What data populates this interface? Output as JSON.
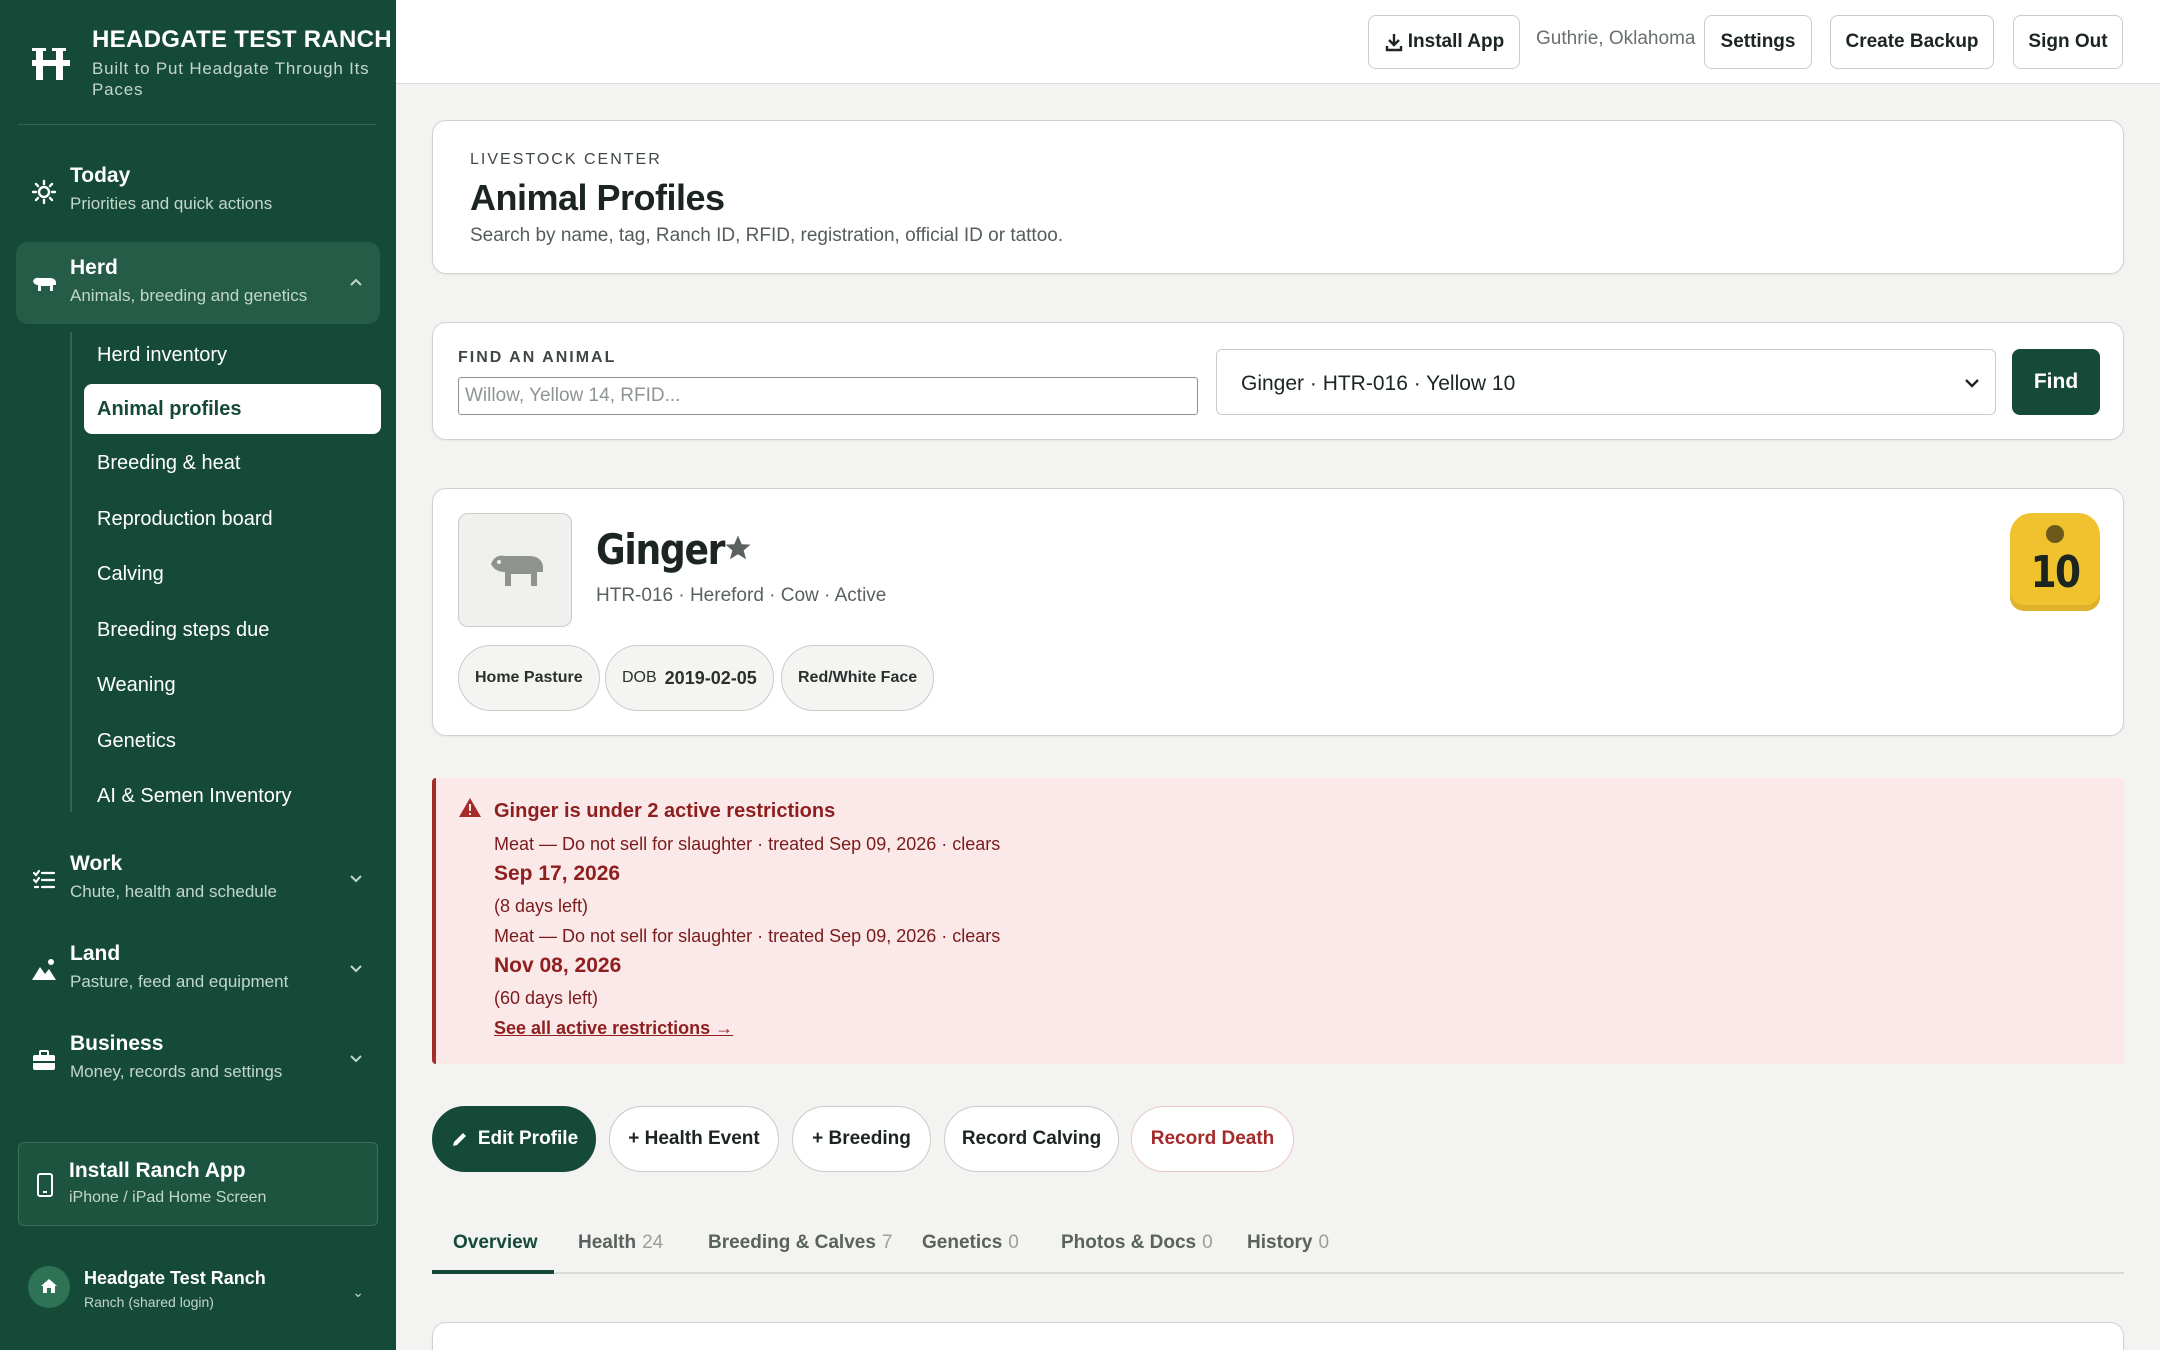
{
  "brand": {
    "title": "HEADGATE TEST RANCH",
    "subtitle": "Built to Put Headgate Through Its Paces",
    "logo_letter": "H"
  },
  "nav": {
    "groups": [
      {
        "title": "Today",
        "subtitle": "Priorities and quick actions",
        "icon": "sun-icon"
      },
      {
        "title": "Herd",
        "subtitle": "Animals, breeding and genetics",
        "icon": "cow-icon",
        "expanded": true
      },
      {
        "title": "Work",
        "subtitle": "Chute, health and schedule",
        "icon": "checklist-icon"
      },
      {
        "title": "Land",
        "subtitle": "Pasture, feed and equipment",
        "icon": "mountain-icon"
      },
      {
        "title": "Business",
        "subtitle": "Money, records and settings",
        "icon": "briefcase-icon"
      }
    ],
    "herd_items": [
      "Herd inventory",
      "Animal profiles",
      "Breeding & heat",
      "Reproduction board",
      "Calving",
      "Breeding steps due",
      "Weaning",
      "Genetics",
      "AI & Semen Inventory"
    ],
    "active_item": "Animal profiles"
  },
  "install_card": {
    "title": "Install Ranch App",
    "subtitle": "iPhone / iPad Home Screen"
  },
  "account": {
    "name": "Headgate Test Ranch",
    "role": "Ranch (shared login)",
    "chevron": "⌄"
  },
  "topbar": {
    "install": "Install App",
    "location": "Guthrie, Oklahoma",
    "settings": "Settings",
    "backup": "Create Backup",
    "signout": "Sign Out"
  },
  "header": {
    "eyebrow": "LIVESTOCK CENTER",
    "title": "Animal Profiles",
    "description": "Search by name, tag, Ranch ID, RFID, registration, official ID or tattoo."
  },
  "find": {
    "label": "FIND AN ANIMAL",
    "placeholder": "Willow, Yellow 14, RFID...",
    "selected": "Ginger · HTR-016 · Yellow 10",
    "button": "Find"
  },
  "animal": {
    "name": "Ginger",
    "meta": "HTR-016 · Hereford · Cow · Active",
    "chips": {
      "pasture": "Home Pasture",
      "dob_label": "DOB",
      "dob": "2019-02-05",
      "marking": "Red/White Face"
    },
    "tag_number": "10",
    "tag_color": "#f0c22e"
  },
  "alert": {
    "title": "Ginger is under 2 active restrictions",
    "items": [
      {
        "line": "Meat — Do not sell for slaughter · treated Sep 09, 2026 · clears",
        "date": "Sep 17, 2026",
        "left": "(8 days left)"
      },
      {
        "line": "Meat — Do not sell for slaughter · treated Sep 09, 2026 · clears",
        "date": "Nov 08, 2026",
        "left": "(60 days left)"
      }
    ],
    "link": "See all active restrictions →"
  },
  "actions": {
    "edit": "Edit Profile",
    "health": "+ Health Event",
    "breeding": "+ Breeding",
    "calving": "Record Calving",
    "death": "Record Death"
  },
  "tabs": [
    {
      "label": "Overview",
      "count": ""
    },
    {
      "label": "Health",
      "count": "24"
    },
    {
      "label": "Breeding & Calves",
      "count": "7"
    },
    {
      "label": "Genetics",
      "count": "0"
    },
    {
      "label": "Photos & Docs",
      "count": "0"
    },
    {
      "label": "History",
      "count": "0"
    }
  ],
  "colors": {
    "primary": "#164a38",
    "alert_text": "#8e1f1f",
    "alert_bg": "#fbe8e8",
    "tag": "#f0c22e"
  }
}
